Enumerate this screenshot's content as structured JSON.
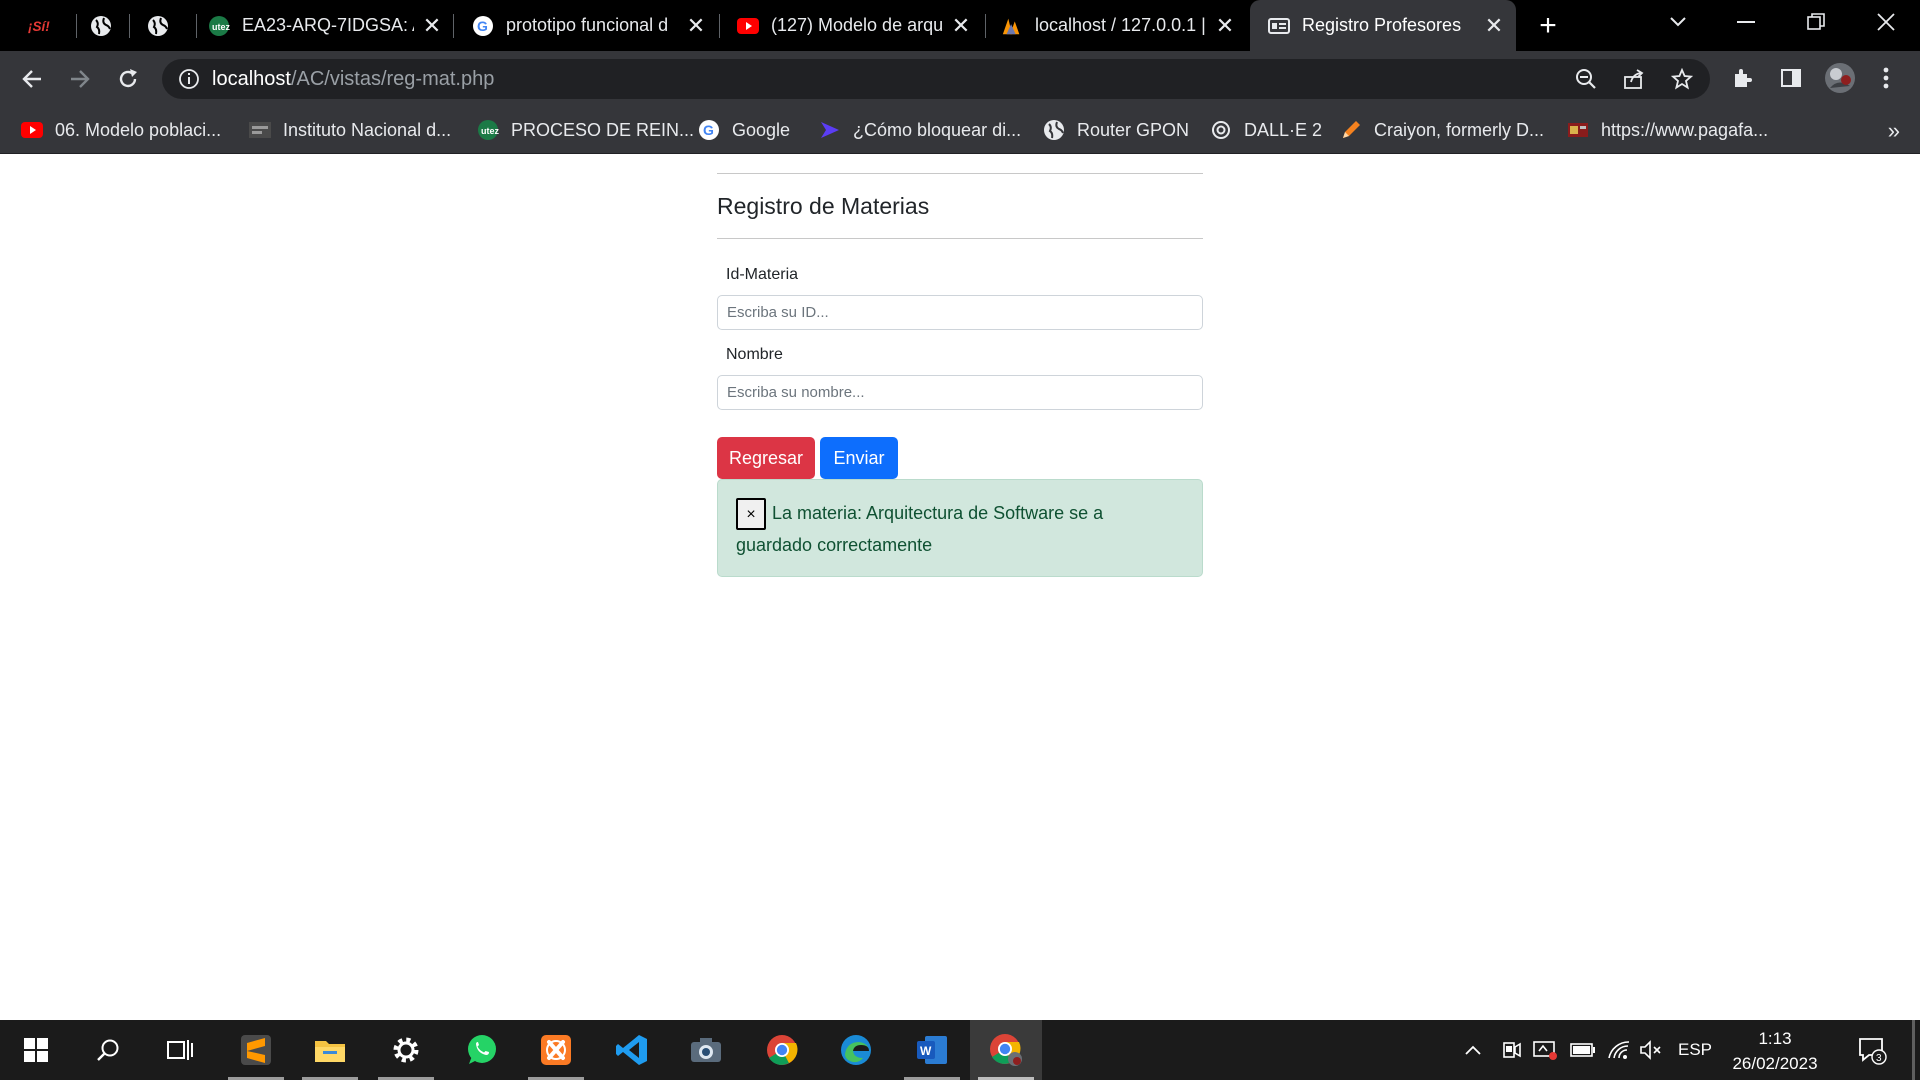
{
  "browser": {
    "tabs": [
      {
        "title": "",
        "icon": "si-logo-icon",
        "active": false
      },
      {
        "title": "",
        "icon": "globe-icon",
        "active": false
      },
      {
        "title": "",
        "icon": "globe-icon",
        "active": false
      },
      {
        "title": "EA23-ARQ-7IDGSA: A",
        "icon": "utez-icon",
        "active": false
      },
      {
        "title": "prototipo funcional d",
        "icon": "google-icon",
        "active": false
      },
      {
        "title": "(127) Modelo de arqu",
        "icon": "youtube-icon",
        "active": false
      },
      {
        "title": "localhost / 127.0.0.1 |",
        "icon": "phpmyadmin-icon",
        "active": false
      },
      {
        "title": "Registro Profesores",
        "icon": "form-icon",
        "active": true
      }
    ],
    "url_host": "localhost",
    "url_path": "/AC/vistas/reg-mat.php",
    "bookmarks": [
      {
        "label": "06. Modelo poblaci...",
        "icon": "youtube-icon"
      },
      {
        "label": "Instituto Nacional d...",
        "icon": "ine-icon"
      },
      {
        "label": "PROCESO DE REIN...",
        "icon": "utez-icon"
      },
      {
        "label": "Google",
        "icon": "google-icon"
      },
      {
        "label": "¿Cómo bloquear di...",
        "icon": "arrow-icon"
      },
      {
        "label": "Router GPON",
        "icon": "globe-icon"
      },
      {
        "label": "DALL·E 2",
        "icon": "openai-icon"
      },
      {
        "label": "Craiyon, formerly D...",
        "icon": "pencil-icon"
      },
      {
        "label": "https://www.pagafa...",
        "icon": "pagafacil-icon"
      }
    ],
    "bookmarks_more": "»"
  },
  "page": {
    "title": "Registro de Materias",
    "id_label": "Id-Materia",
    "id_placeholder": "Escriba su ID...",
    "name_label": "Nombre",
    "name_placeholder": "Escriba su nombre...",
    "back_button": "Regresar",
    "send_button": "Enviar",
    "alert_close": "×",
    "alert_message": "La materia: Arquitectura de Software se a guardado correctamente"
  },
  "taskbar": {
    "apps": [
      "sublime-text-icon",
      "file-explorer-icon",
      "settings-icon",
      "whatsapp-icon",
      "xampp-icon",
      "vscode-icon",
      "camera-icon",
      "chrome-icon",
      "edge-icon",
      "word-icon",
      "chrome-profile-icon"
    ],
    "language": "ESP",
    "time": "1:13",
    "date": "26/02/2023",
    "notifications": "3"
  },
  "colors": {
    "danger": "#dc3545",
    "primary": "#0d6efd",
    "success_bg": "#d1e7dd",
    "success_text": "#0f5132"
  }
}
